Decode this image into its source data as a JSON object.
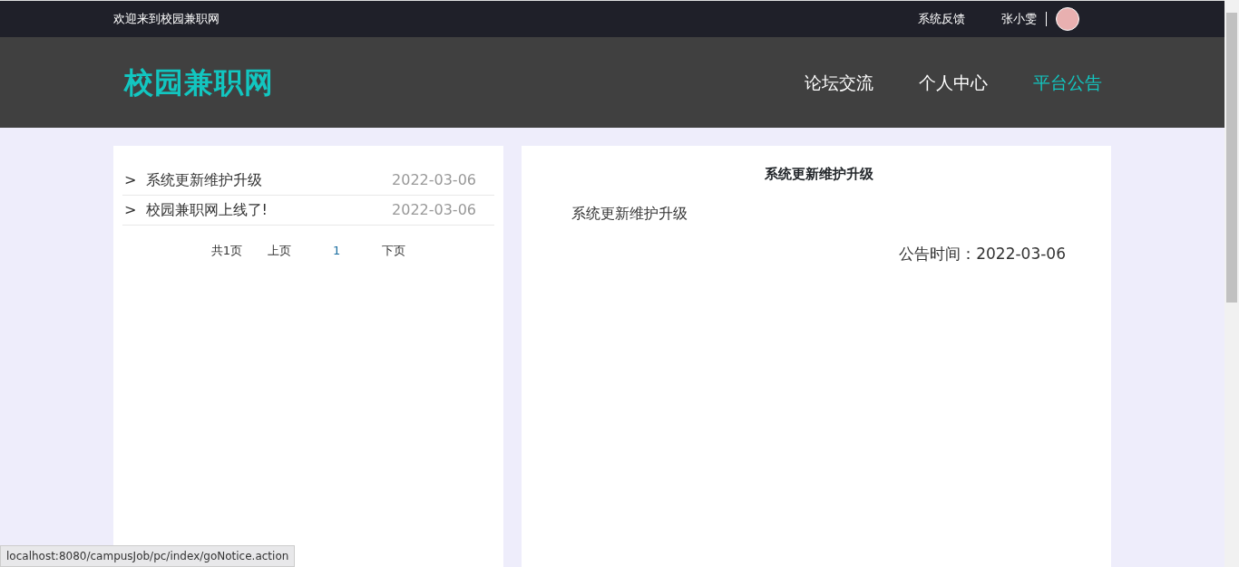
{
  "top_bar": {
    "welcome": "欢迎来到校园兼职网",
    "feedback": "系统反馈",
    "username": "张小雯"
  },
  "header": {
    "logo": "校园兼职网",
    "nav": [
      {
        "label": "论坛交流",
        "selected": false
      },
      {
        "label": "个人中心",
        "selected": false
      },
      {
        "label": "平台公告",
        "selected": true
      }
    ]
  },
  "notice_list": {
    "items": [
      {
        "marker": ">",
        "title": "系统更新维护升级",
        "date": "2022-03-06"
      },
      {
        "marker": ">",
        "title": "校园兼职网上线了!",
        "date": "2022-03-06"
      }
    ],
    "pagination": {
      "total": "共1页",
      "prev": "上页",
      "pages": [
        {
          "label": "1",
          "selected": true
        }
      ],
      "next": "下页"
    }
  },
  "notice_detail": {
    "title": "系统更新维护升级",
    "body": "系统更新维护升级",
    "time": "公告时间：2022-03-06"
  },
  "status_bar": "localhost:8080/campusJob/pc/index/goNotice.action"
}
